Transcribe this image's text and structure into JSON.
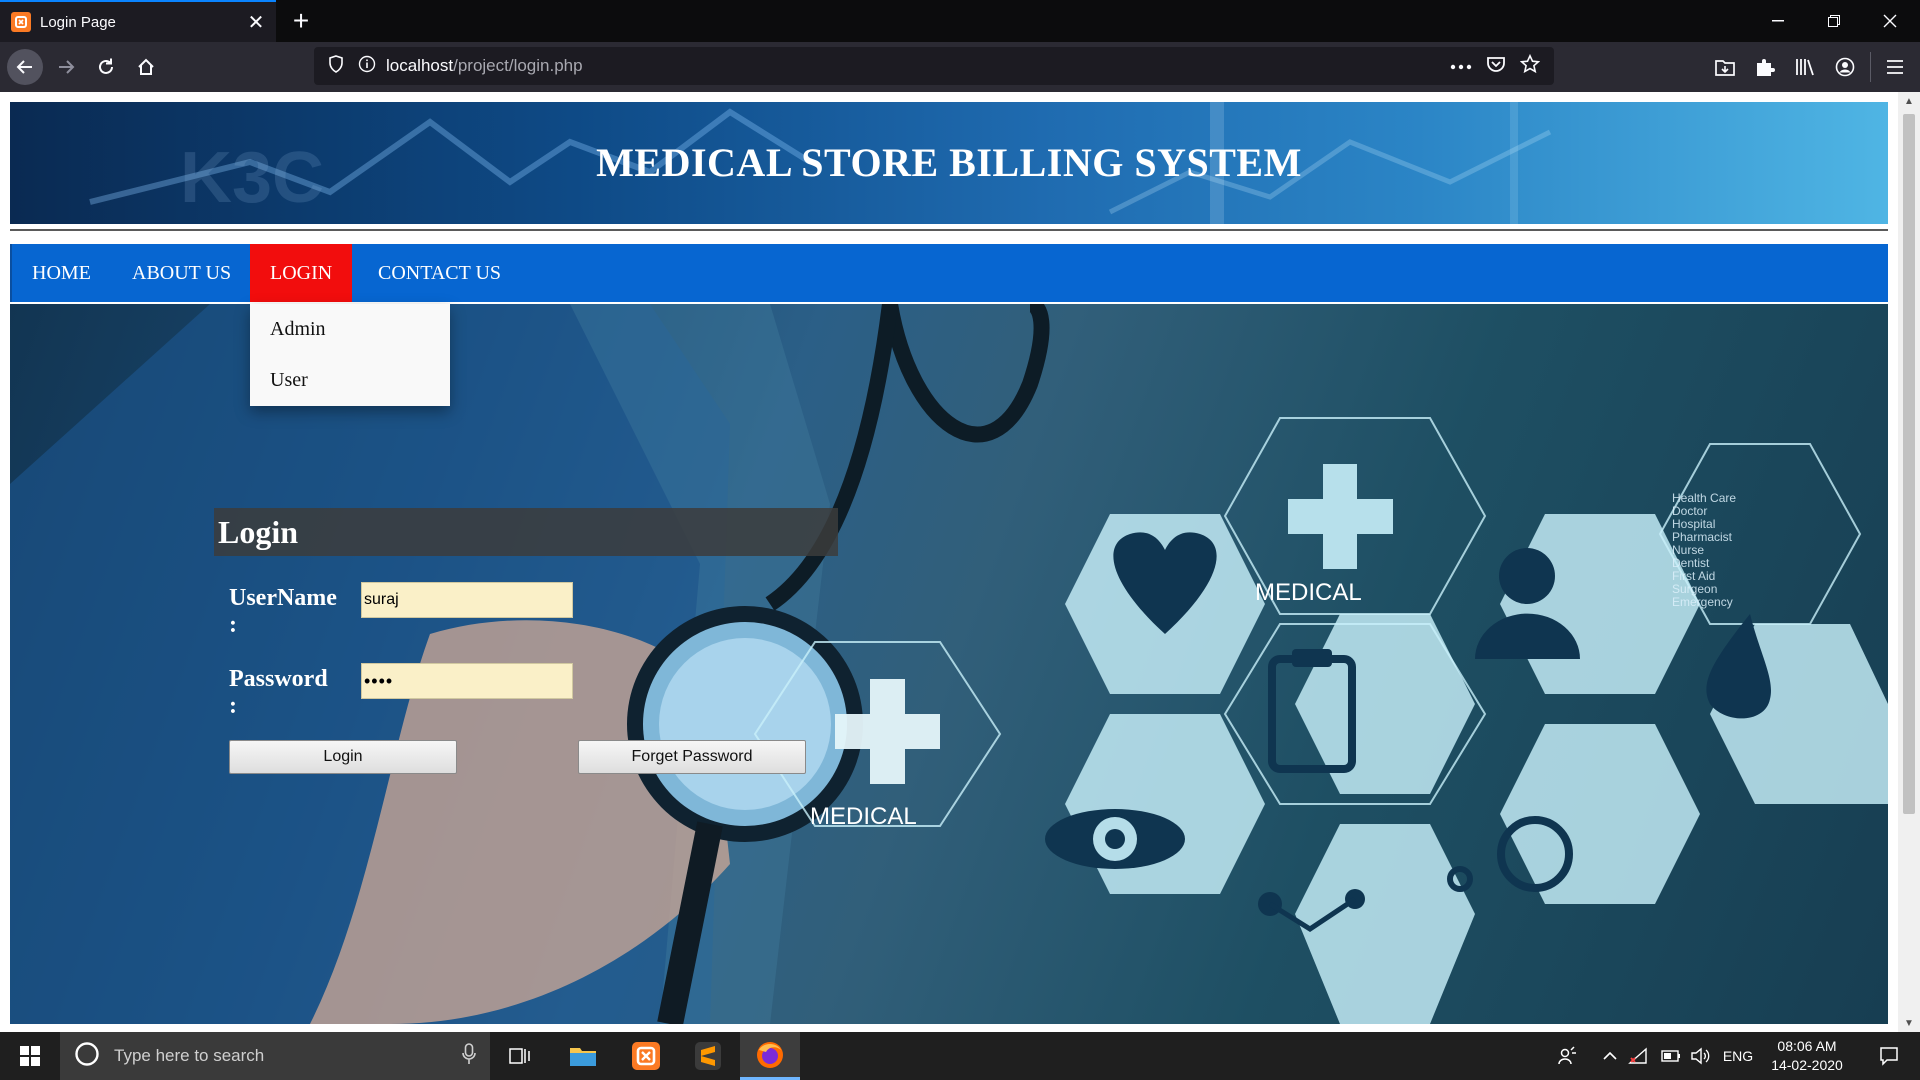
{
  "browser": {
    "tab_title": "Login Page",
    "url_host": "localhost",
    "url_path": "/project/login.php"
  },
  "page": {
    "banner_title": "MEDICAL STORE BILLING SYSTEM",
    "menu": [
      {
        "label": "HOME"
      },
      {
        "label": "ABOUT US"
      },
      {
        "label": "LOGIN"
      },
      {
        "label": "CONTACT US"
      }
    ],
    "login_dropdown": [
      {
        "label": "Admin"
      },
      {
        "label": "User"
      }
    ],
    "login_form": {
      "title": "Login",
      "username_label": "UserName :",
      "username_value": "suraj",
      "password_label": "Password :",
      "password_value": "••••",
      "login_button": "Login",
      "forget_button": "Forget Password"
    },
    "background_image": {
      "hex_labels": [
        "MEDICAL",
        "MEDICAL"
      ],
      "side_list": [
        "Health Care",
        "Doctor",
        "Hospital",
        "Pharmacist",
        "Nurse",
        "Dentist",
        "First Aid",
        "Surgeon",
        "Emergency"
      ]
    }
  },
  "taskbar": {
    "search_placeholder": "Type here to search",
    "language": "ENG",
    "time": "08:06 AM",
    "date": "14-02-2020"
  },
  "colors": {
    "menu_bar": "#0766d1",
    "menu_active": "#f20d0d",
    "input_bg": "#faf0c8",
    "tab_accent": "#0a84ff"
  }
}
